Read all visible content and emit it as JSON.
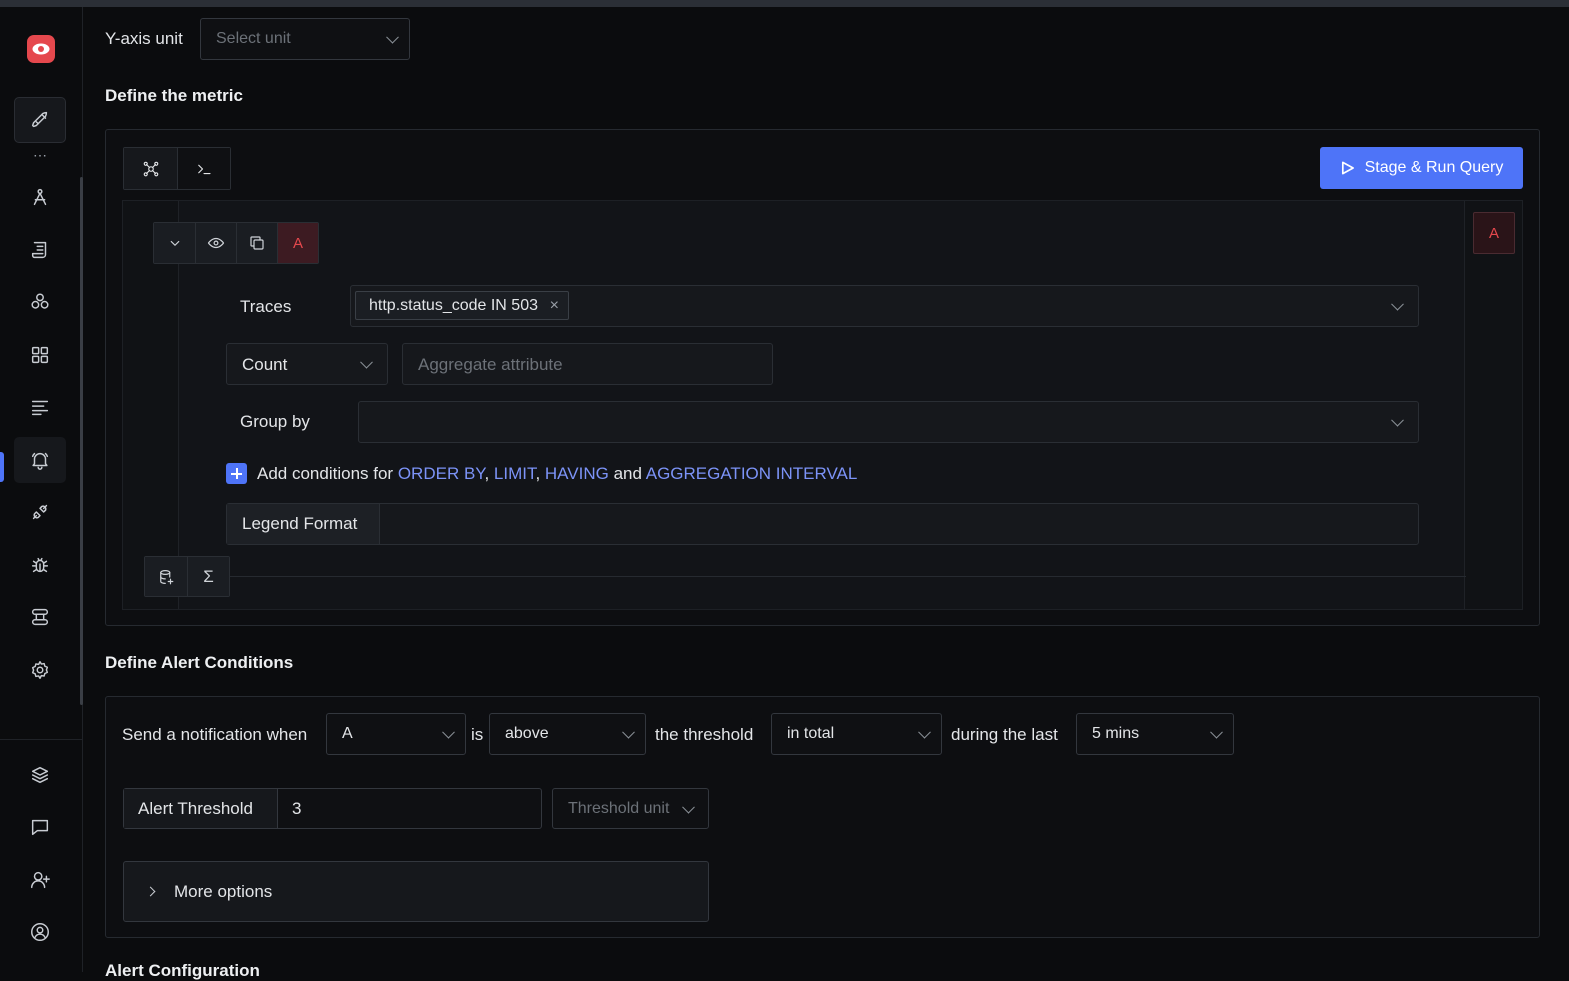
{
  "sidebar": {
    "items": [
      "rocket-icon",
      "pen-tool-icon",
      "logs-icon",
      "apps-icon",
      "dashboard-icon",
      "list-icon",
      "alert-bell-icon",
      "plug-icon",
      "bug-icon",
      "pipeline-icon",
      "settings-icon",
      "layers-icon",
      "chat-icon",
      "invite-user-icon",
      "account-icon"
    ],
    "active_item": "alert-bell-icon",
    "accent_color": "#4e74f8"
  },
  "yaxis": {
    "label": "Y-axis unit",
    "placeholder": "Select unit"
  },
  "define_metric": {
    "title": "Define the metric",
    "run_button": "Stage & Run Query",
    "query": {
      "letter": "A",
      "badge": "A",
      "data_source_label": "Traces",
      "filter_tag": "http.status_code IN 503",
      "aggregate_op": "Count",
      "aggregate_placeholder": "Aggregate attribute",
      "group_by_label": "Group by",
      "add_conditions": {
        "prefix": "Add conditions for",
        "order_by": "ORDER BY",
        "limit": "LIMIT",
        "having": "HAVING",
        "and": "and",
        "interval": "AGGREGATION INTERVAL"
      },
      "legend_label": "Legend Format",
      "sigma": "Σ"
    }
  },
  "alert_conditions": {
    "title": "Define Alert Conditions",
    "send_when": "Send a notification when",
    "query_select": "A",
    "is": "is",
    "op_select": "above",
    "the_threshold": "the threshold",
    "match_select": "in total",
    "during_last": "during the last",
    "window_select": "5 mins",
    "threshold_label": "Alert Threshold",
    "threshold_value": "3",
    "threshold_unit_placeholder": "Threshold unit",
    "more_options": "More options"
  },
  "next_section_title": "Alert Configuration"
}
